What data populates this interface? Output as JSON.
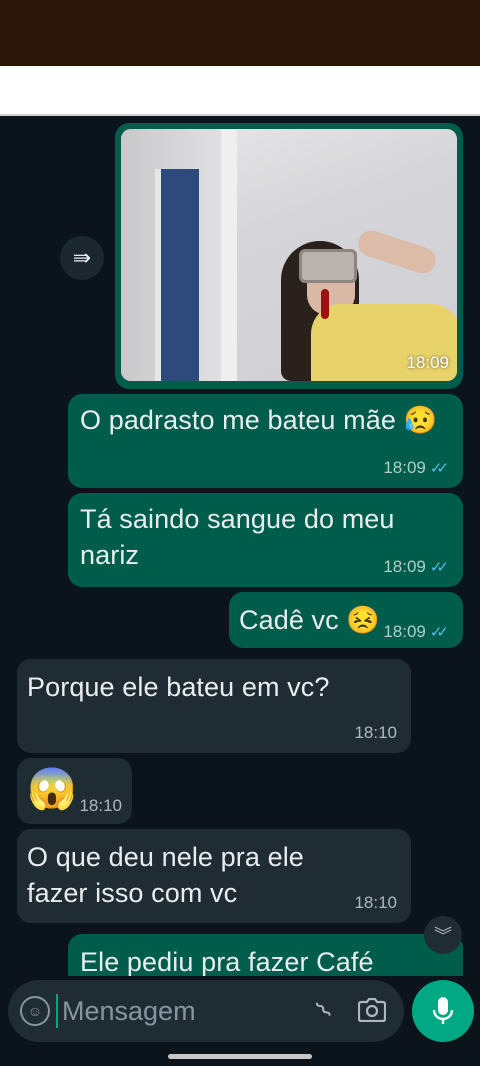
{
  "messages": [
    {
      "type": "image",
      "direction": "outgoing",
      "time": "18:09"
    },
    {
      "type": "text",
      "direction": "outgoing",
      "text": "O padrasto me bateu mãe 😥",
      "time": "18:09",
      "read": true
    },
    {
      "type": "text",
      "direction": "outgoing",
      "text": "Tá saindo sangue do meu nariz",
      "time": "18:09",
      "read": true
    },
    {
      "type": "text",
      "direction": "outgoing",
      "text": "Cadê vc 😣",
      "time": "18:09",
      "read": true
    },
    {
      "type": "text",
      "direction": "incoming",
      "text": "Porque ele bateu em vc?",
      "time": "18:10"
    },
    {
      "type": "text",
      "direction": "incoming",
      "text": "😱",
      "time": "18:10"
    },
    {
      "type": "text",
      "direction": "incoming",
      "text": "O que deu nele pra ele fazer isso com vc",
      "time": "18:10"
    },
    {
      "type": "text",
      "direction": "outgoing",
      "text": "Ele pediu pra fazer Café",
      "time": ""
    }
  ],
  "composer": {
    "placeholder": "Mensagem"
  },
  "icons": {
    "forward": "forward-icon",
    "scroll_down": "double-chevron-down-icon",
    "emoji": "emoji-icon",
    "attach": "paperclip-icon",
    "camera": "camera-icon",
    "mic": "microphone-icon"
  },
  "colors": {
    "background": "#0b141a",
    "outgoing_bubble": "#005c4b",
    "incoming_bubble": "#202c33",
    "accent": "#00a884",
    "read_tick": "#53bdeb"
  }
}
